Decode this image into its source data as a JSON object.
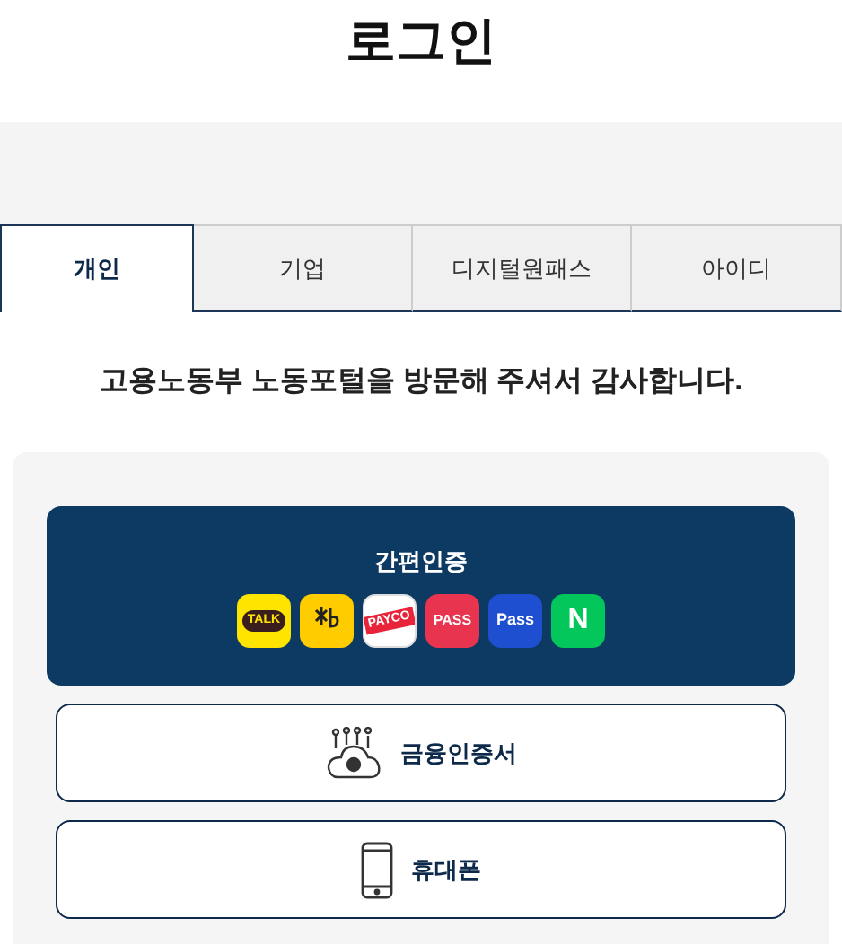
{
  "title": "로그인",
  "tabs": [
    {
      "label": "개인",
      "selected": true
    },
    {
      "label": "기업",
      "selected": false
    },
    {
      "label": "디지털원패스",
      "selected": false
    },
    {
      "label": "아이디",
      "selected": false
    }
  ],
  "welcome": "고용노동부 노동포털을 방문해 주셔서 감사합니다.",
  "easy_auth": {
    "title": "간편인증",
    "providers": [
      {
        "kind": "talk",
        "label": "TALK",
        "color": "#fee500"
      },
      {
        "kind": "kb",
        "color": "#ffcc00"
      },
      {
        "kind": "payco",
        "label": "PAYCO",
        "color": "#ffffff"
      },
      {
        "kind": "pass",
        "label": "PASS",
        "color": "#e8344e"
      },
      {
        "kind": "samsung",
        "label": "Pass",
        "color": "#1f4fd1"
      },
      {
        "kind": "naver",
        "label": "N",
        "color": "#03c75a"
      }
    ]
  },
  "methods": [
    {
      "kind": "certificate",
      "label": "금융인증서"
    },
    {
      "kind": "phone",
      "label": "휴대폰"
    }
  ]
}
